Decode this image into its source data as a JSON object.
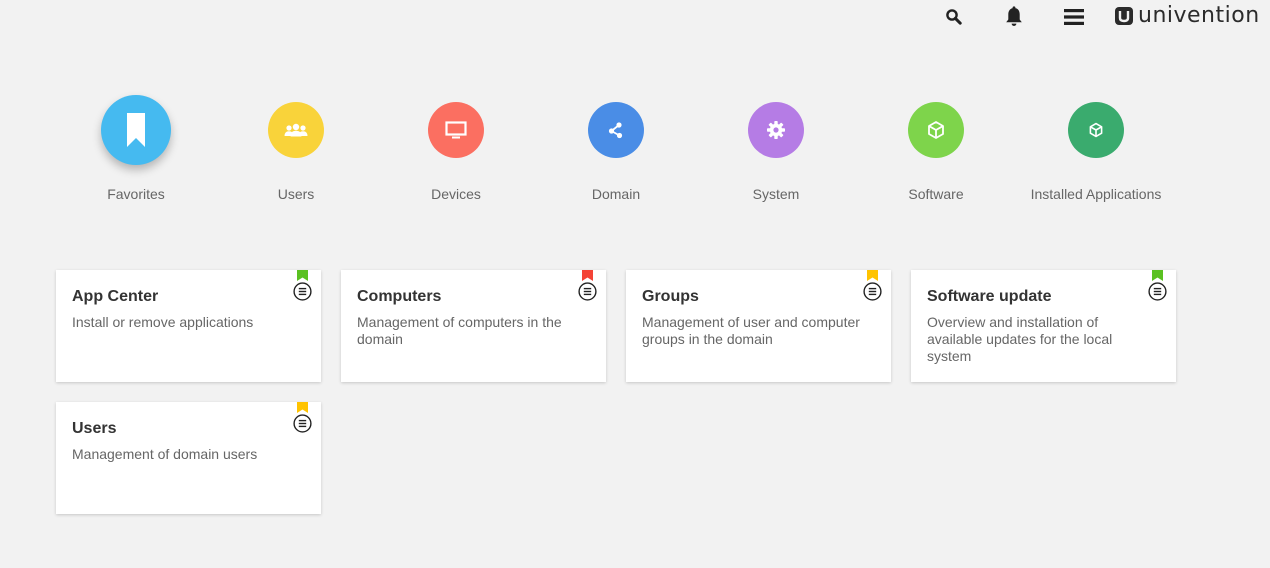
{
  "header": {
    "logo_text": "univention",
    "icons": [
      "search-icon",
      "bell-icon",
      "menu-icon"
    ]
  },
  "colors": {
    "favorites": "#45baf0",
    "users": "#f9d33a",
    "devices": "#fb6f61",
    "domain": "#4a8de6",
    "system": "#b57ce5",
    "software": "#7ed44b",
    "installed": "#3aab6e",
    "flag_green": "#5ac121",
    "flag_red": "#f44336",
    "flag_yellow": "#ffc300"
  },
  "categories": [
    {
      "label": "Favorites",
      "icon": "bookmark-icon",
      "active": true
    },
    {
      "label": "Users",
      "icon": "users-icon"
    },
    {
      "label": "Devices",
      "icon": "monitor-icon"
    },
    {
      "label": "Domain",
      "icon": "share-icon"
    },
    {
      "label": "System",
      "icon": "gear-icon"
    },
    {
      "label": "Software",
      "icon": "package-icon"
    },
    {
      "label": "Installed Applications",
      "icon": "package-icon"
    }
  ],
  "tiles": [
    {
      "title": "App Center",
      "description": "Install or remove applications",
      "flag": "green"
    },
    {
      "title": "Computers",
      "description": "Management of computers in the domain",
      "flag": "red"
    },
    {
      "title": "Groups",
      "description": "Management of user and computer groups in the domain",
      "flag": "yellow"
    },
    {
      "title": "Software update",
      "description": "Overview and installation of available updates for the local system",
      "flag": "green"
    },
    {
      "title": "Users",
      "description": "Management of domain users",
      "flag": "yellow"
    }
  ]
}
